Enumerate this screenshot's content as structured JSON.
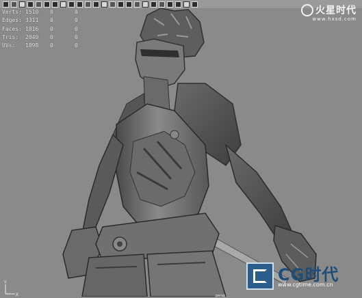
{
  "toolbar": {
    "icons": [
      "select-icon",
      "lasso-icon",
      "paint-icon",
      "move-icon",
      "rotate-icon",
      "scale-icon",
      "grid-icon",
      "snap-icon",
      "camera-icon",
      "light-icon",
      "render-icon",
      "shade-icon",
      "wire-icon",
      "texture-icon",
      "cube-icon",
      "sphere-icon",
      "cylinder-icon",
      "plane-icon",
      "torus-icon",
      "curve-icon",
      "box-icon",
      "isolate-icon",
      "xray-icon",
      "frame-icon"
    ]
  },
  "hud": {
    "rows": [
      {
        "label": "Verts:",
        "value": "1510",
        "selected": "0",
        "uv": "0"
      },
      {
        "label": "Edges:",
        "value": "3311",
        "selected": "0",
        "uv": "0"
      },
      {
        "label": "Faces:",
        "value": "1816",
        "selected": "0",
        "uv": "0"
      },
      {
        "label": "Tris:",
        "value": "2040",
        "selected": "0",
        "uv": "0"
      },
      {
        "label": "UVs:",
        "value": "1898",
        "selected": "0",
        "uv": "0"
      }
    ]
  },
  "watermark_top": {
    "brand": "火星时代",
    "url": "www.hxsd.com"
  },
  "watermark_bottom": {
    "brand": "CG时代",
    "url": "www.cgtime.com.cn"
  },
  "axis": {
    "x": "X",
    "y": "Y"
  },
  "viewport": {
    "label": "persp"
  },
  "colors": {
    "background": "#8a8a8a",
    "model": "#6f6f6f",
    "brand_blue": "#1d4e7a"
  }
}
